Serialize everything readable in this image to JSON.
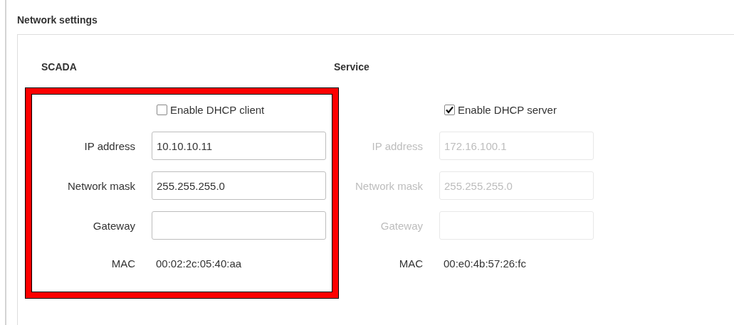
{
  "title": "Network settings",
  "sections": [
    {
      "heading": "SCADA",
      "highlighted": true,
      "dhcp": {
        "label": "Enable DHCP client",
        "checked": false
      },
      "fields": [
        {
          "label": "IP address",
          "value": "10.10.10.11",
          "disabled": false
        },
        {
          "label": "Network mask",
          "value": "255.255.255.0",
          "disabled": false
        },
        {
          "label": "Gateway",
          "disabled": false
        }
      ],
      "mac": {
        "label": "MAC",
        "value": "00:02:2c:05:40:aa"
      }
    },
    {
      "heading": "Service",
      "highlighted": false,
      "dhcp": {
        "label": "Enable DHCP server",
        "checked": true
      },
      "fields": [
        {
          "label": "IP address",
          "value": "172.16.100.1",
          "disabled": true
        },
        {
          "label": "Network mask",
          "value": "255.255.255.0",
          "disabled": true
        },
        {
          "label": "Gateway",
          "disabled": true
        }
      ],
      "mac": {
        "label": "MAC",
        "value": "00:e0:4b:57:26:fc"
      }
    }
  ]
}
